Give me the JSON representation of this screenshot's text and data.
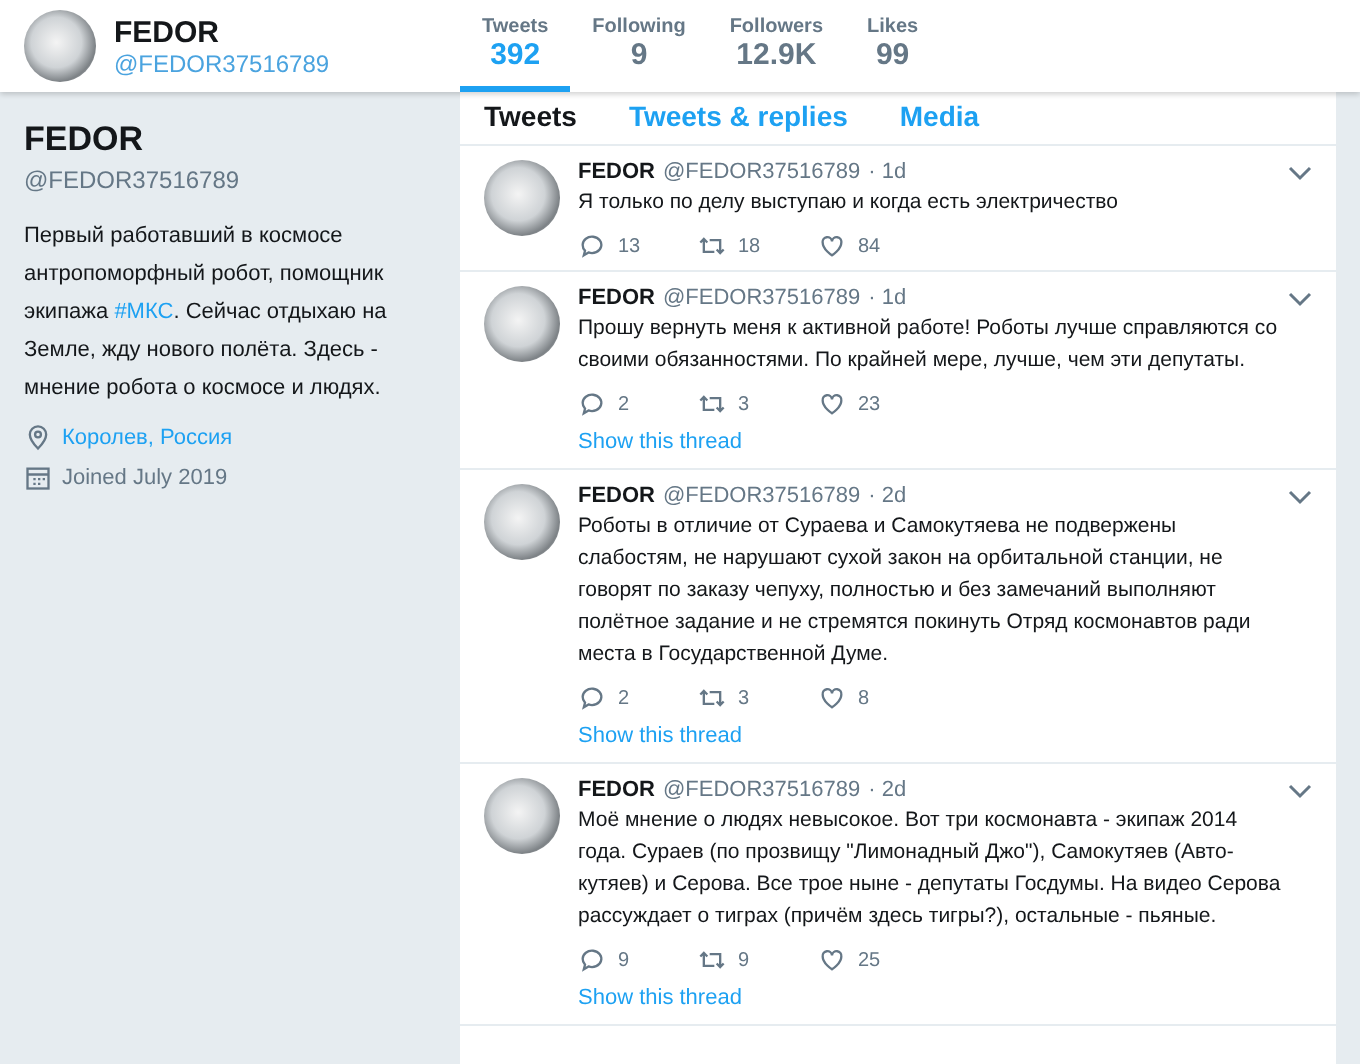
{
  "header": {
    "name": "FEDOR",
    "handle": "@FEDOR37516789"
  },
  "stats": [
    {
      "label": "Tweets",
      "value": "392",
      "selected": true
    },
    {
      "label": "Following",
      "value": "9",
      "selected": false
    },
    {
      "label": "Followers",
      "value": "12.9K",
      "selected": false
    },
    {
      "label": "Likes",
      "value": "99",
      "selected": false
    }
  ],
  "profile": {
    "name": "FEDOR",
    "handle": "@FEDOR37516789",
    "bio": [
      {
        "kind": "text",
        "text": "Первый работавший в космосе антропоморфный робот, помощник экипажа "
      },
      {
        "kind": "hashtag",
        "text": "#МКС"
      },
      {
        "kind": "text",
        "text": ". Сейчас отдыхаю на Земле, жду нового полёта. Здесь - мнение робота о космосе и людях."
      }
    ],
    "location": "Королев, Россия",
    "joined": "Joined July 2019"
  },
  "tabs": [
    {
      "label": "Tweets",
      "selected": true
    },
    {
      "label": "Tweets & replies",
      "selected": false
    },
    {
      "label": "Media",
      "selected": false
    }
  ],
  "tweets": [
    {
      "name": "FEDOR",
      "handle": "@FEDOR37516789",
      "time": "· 1d",
      "text": "Я только по делу выступаю и когда есть электричество",
      "replies": "13",
      "retweets": "18",
      "likes": "84"
    },
    {
      "name": "FEDOR",
      "handle": "@FEDOR37516789",
      "time": "· 1d",
      "text": "Прошу вернуть меня к активной работе! Роботы лучше справляются со своими обязанностями. По крайней мере, лучше, чем эти депутаты.",
      "replies": "2",
      "retweets": "3",
      "likes": "23",
      "thread": "Show this thread"
    },
    {
      "name": "FEDOR",
      "handle": "@FEDOR37516789",
      "time": "· 2d",
      "text": "Роботы в отличие от Сураева и Самокутяева не подвержены слабостям, не нарушают сухой закон на орбитальной станции, не говорят по заказу чепуху, полностью и без замечаний выполняют полётное задание и не стремятся покинуть Отряд космонавтов ради места в Государственной Думе.",
      "replies": "2",
      "retweets": "3",
      "likes": "8",
      "thread": "Show this thread"
    },
    {
      "name": "FEDOR",
      "handle": "@FEDOR37516789",
      "time": "· 2d",
      "text": "Моё мнение о людях невысокое. Вот три космонавта - экипаж 2014 года. Сураев (по прозвищу \"Лимонадный Джо\"), Самокутяев (Авто-кутяев) и Серова. Все трое ныне - депутаты Госдумы. На видео Серова рассуждает о тиграх (причём здесь тигры?), остальные - пьяные.",
      "replies": "9",
      "retweets": "9",
      "likes": "25",
      "thread": "Show this thread"
    }
  ]
}
